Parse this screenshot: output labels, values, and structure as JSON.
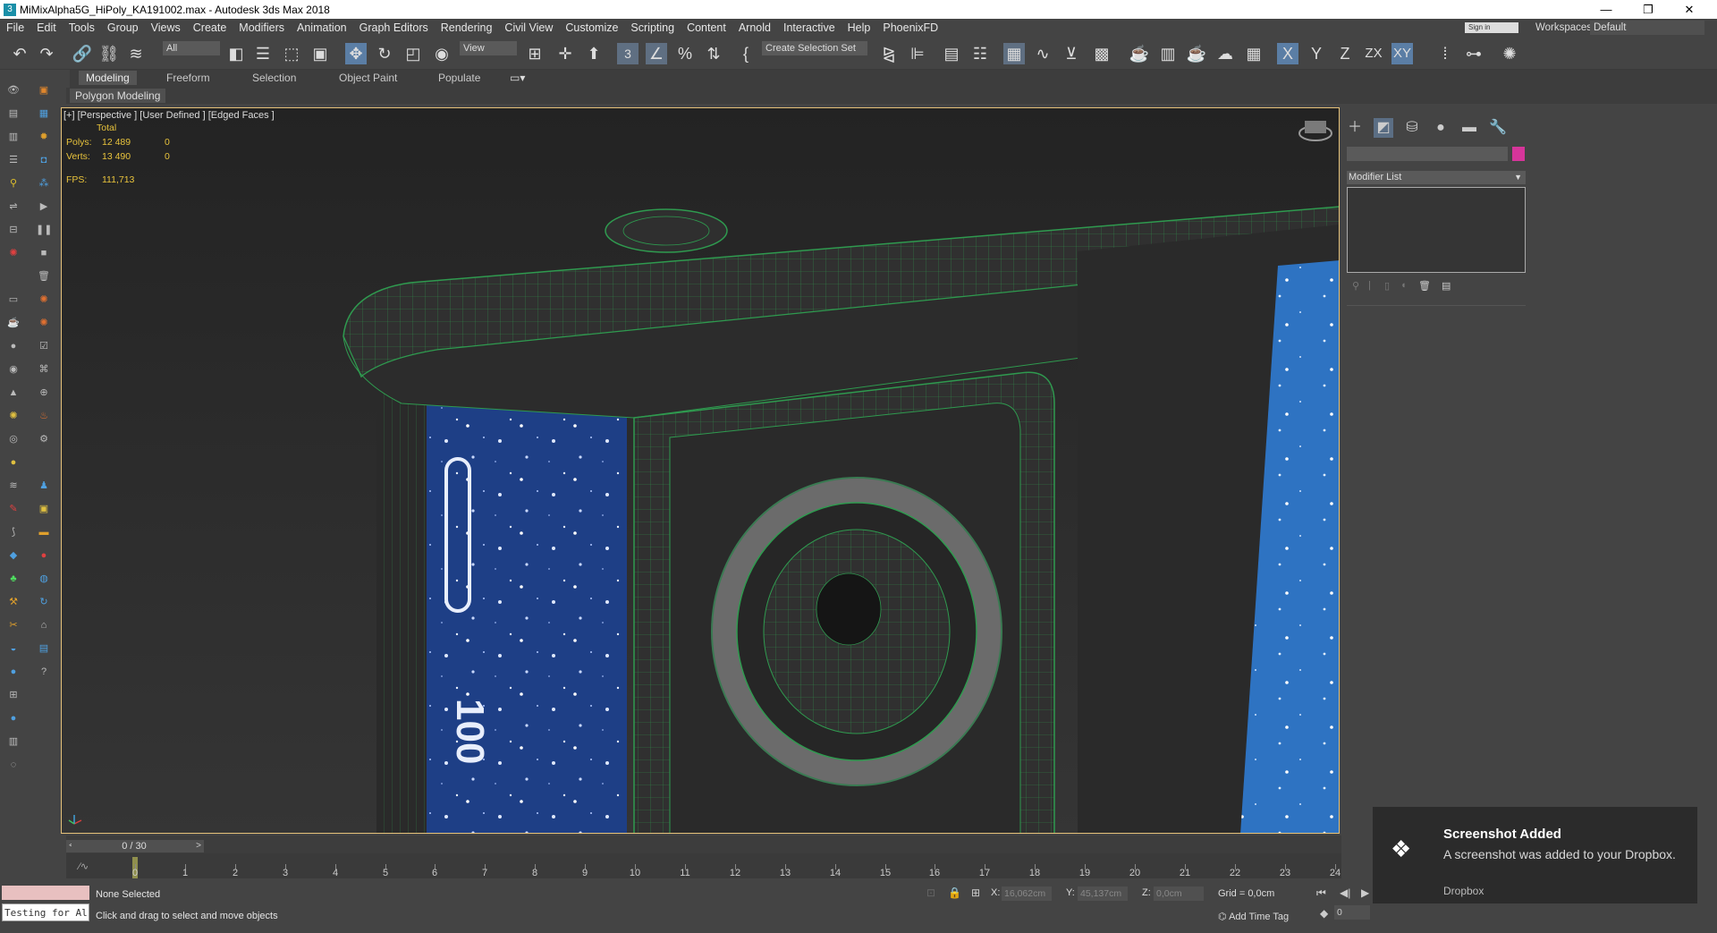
{
  "window": {
    "title": "MiMixAlpha5G_HiPoly_KA191002.max - Autodesk 3ds Max 2018",
    "app_icon": "3",
    "minimize": "—",
    "restore": "❐",
    "close": "✕"
  },
  "menu": [
    "File",
    "Edit",
    "Tools",
    "Group",
    "Views",
    "Create",
    "Modifiers",
    "Animation",
    "Graph Editors",
    "Rendering",
    "Civil View",
    "Customize",
    "Scripting",
    "Content",
    "Arnold",
    "Interactive",
    "Help",
    "PhoenixFD"
  ],
  "signin": "Sign in",
  "workspaces": {
    "label": "Workspaces:",
    "value": "Default"
  },
  "toolbar": {
    "filter": "All",
    "ref_coord": "View",
    "selection_set": "Create Selection Set",
    "snap_label": "3",
    "x_axis": "X",
    "y_axis": "Y",
    "z_axis": "Z",
    "zx_axis": "ZX",
    "xy_axis": "XY"
  },
  "ribbon": {
    "tabs": [
      "Modeling",
      "Freeform",
      "Selection",
      "Object Paint",
      "Populate"
    ],
    "active_tab": "Modeling",
    "sub_label": "Polygon Modeling"
  },
  "viewport": {
    "label": "[+] [Perspective ] [User Defined ] [Edged Faces ]",
    "stats_header": "Total",
    "polys_label": "Polys:",
    "polys_total": "12 489",
    "polys_sel": "0",
    "verts_label": "Verts:",
    "verts_total": "13 490",
    "verts_sel": "0",
    "fps_label": "FPS:",
    "fps_value": "111,713",
    "side_text": "100"
  },
  "command_panel": {
    "modifier_list": "Modifier List",
    "color": "#d6359a"
  },
  "timeline": {
    "frame_display": "0 / 30",
    "ticks": [
      "0",
      "1",
      "2",
      "3",
      "4",
      "5",
      "6",
      "7",
      "8",
      "9",
      "10",
      "11",
      "12",
      "13",
      "14",
      "15",
      "16",
      "17",
      "18",
      "19",
      "20",
      "21",
      "22",
      "23",
      "24"
    ]
  },
  "status": {
    "selection": "None Selected",
    "prompt": "Click and drag to select and move objects",
    "maxscript_text": "Testing for Al",
    "x_label": "X:",
    "x_value": "16,062cm",
    "y_label": "Y:",
    "y_value": "45,137cm",
    "z_label": "Z:",
    "z_value": "0,0cm",
    "grid": "Grid = 0,0cm",
    "add_time_tag": "Add Time Tag",
    "frame_field": "0"
  },
  "toast": {
    "title": "Screenshot Added",
    "body": "A screenshot was added to your Dropbox.",
    "source": "Dropbox"
  }
}
